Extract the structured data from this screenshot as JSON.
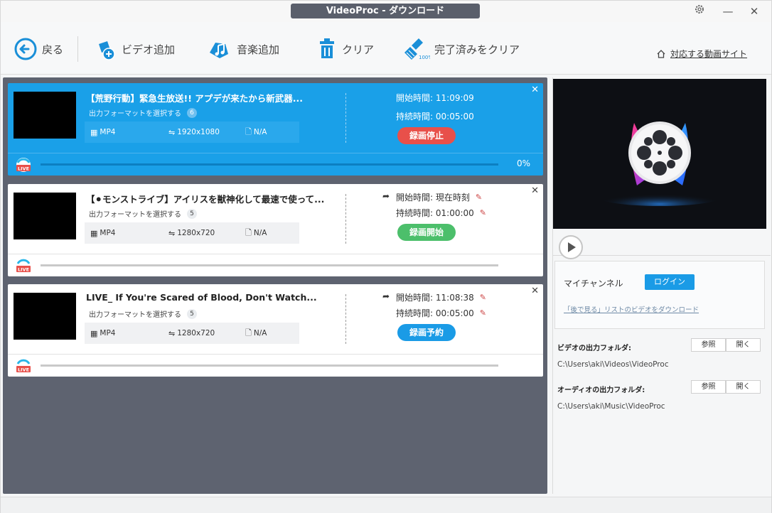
{
  "window": {
    "title": "VideoProc - ダウンロード"
  },
  "toolbar": {
    "back_label": "戻る",
    "add_video_label": "ビデオ追加",
    "add_music_label": "音楽追加",
    "clear_label": "クリア",
    "clear_done_label": "完了済みをクリア",
    "supported_sites_label": "対応する動画サイト"
  },
  "tasks": [
    {
      "title": "【荒野行動】緊急生放送!! アプデが来たから新武器...",
      "format_label": "出力フォーマットを選択する",
      "format_count": "6",
      "container": "MP4",
      "resolution": "1920x1080",
      "size": "N/A",
      "start_label": "開始時間:",
      "start_value": "11:09:09",
      "duration_label": "持続時間:",
      "duration_value": "00:05:00",
      "button_label": "録画停止",
      "button_color": "#e8504a",
      "progress_text": "0%",
      "progress": 0,
      "live_label": "LIVE"
    },
    {
      "title": "【⚫モンストライブ】アイリスを獣神化して最速で使って...",
      "format_label": "出力フォーマットを選択する",
      "format_count": "5",
      "container": "MP4",
      "resolution": "1280x720",
      "size": "N/A",
      "start_label": "開始時間:",
      "start_value": "現在時刻",
      "duration_label": "持続時間:",
      "duration_value": "01:00:00",
      "button_label": "録画開始",
      "button_color": "#4cbf6b",
      "live_label": "LIVE"
    },
    {
      "title": "LIVE_ If You're Scared of Blood, Don't Watch...",
      "format_label": "出力フォーマットを選択する",
      "format_count": "5",
      "container": "MP4",
      "resolution": "1280x720",
      "size": "N/A",
      "start_label": "開始時間:",
      "start_value": "11:08:38",
      "duration_label": "持続時間:",
      "duration_value": "00:05:00",
      "button_label": "録画予約",
      "button_color": "#1a9be6",
      "live_label": "LIVE"
    }
  ],
  "sidebar": {
    "channel_label": "マイチャンネル",
    "login_label": "ログイン",
    "watch_later_link": "「後で見る」リストのビデオをダウンロード",
    "video_folder_label": "ビデオの出力フォルダ:",
    "video_folder_path": "C:\\Users\\aki\\Videos\\VideoProc",
    "audio_folder_label": "オーディオの出力フォルダ:",
    "audio_folder_path": "C:\\Users\\aki\\Music\\VideoProc",
    "browse_label": "参照",
    "open_label": "開く"
  },
  "colors": {
    "accent": "#1aa0e8",
    "list_bg": "#5e6370"
  }
}
